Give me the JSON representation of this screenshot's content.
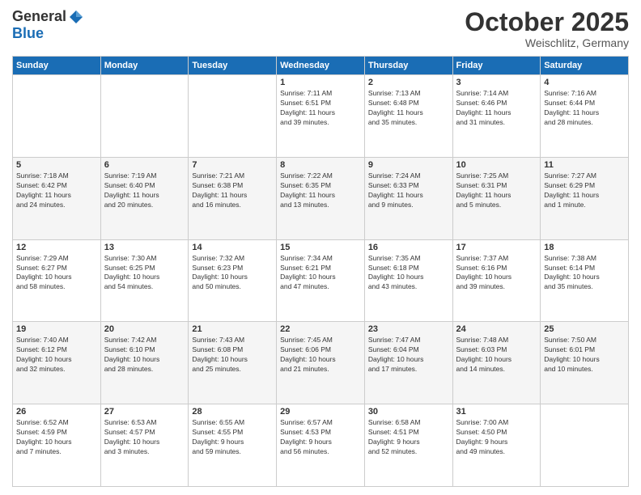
{
  "logo": {
    "general": "General",
    "blue": "Blue"
  },
  "title": "October 2025",
  "subtitle": "Weischlitz, Germany",
  "days_of_week": [
    "Sunday",
    "Monday",
    "Tuesday",
    "Wednesday",
    "Thursday",
    "Friday",
    "Saturday"
  ],
  "weeks": [
    [
      {
        "day": "",
        "info": ""
      },
      {
        "day": "",
        "info": ""
      },
      {
        "day": "",
        "info": ""
      },
      {
        "day": "1",
        "info": "Sunrise: 7:11 AM\nSunset: 6:51 PM\nDaylight: 11 hours\nand 39 minutes."
      },
      {
        "day": "2",
        "info": "Sunrise: 7:13 AM\nSunset: 6:48 PM\nDaylight: 11 hours\nand 35 minutes."
      },
      {
        "day": "3",
        "info": "Sunrise: 7:14 AM\nSunset: 6:46 PM\nDaylight: 11 hours\nand 31 minutes."
      },
      {
        "day": "4",
        "info": "Sunrise: 7:16 AM\nSunset: 6:44 PM\nDaylight: 11 hours\nand 28 minutes."
      }
    ],
    [
      {
        "day": "5",
        "info": "Sunrise: 7:18 AM\nSunset: 6:42 PM\nDaylight: 11 hours\nand 24 minutes."
      },
      {
        "day": "6",
        "info": "Sunrise: 7:19 AM\nSunset: 6:40 PM\nDaylight: 11 hours\nand 20 minutes."
      },
      {
        "day": "7",
        "info": "Sunrise: 7:21 AM\nSunset: 6:38 PM\nDaylight: 11 hours\nand 16 minutes."
      },
      {
        "day": "8",
        "info": "Sunrise: 7:22 AM\nSunset: 6:35 PM\nDaylight: 11 hours\nand 13 minutes."
      },
      {
        "day": "9",
        "info": "Sunrise: 7:24 AM\nSunset: 6:33 PM\nDaylight: 11 hours\nand 9 minutes."
      },
      {
        "day": "10",
        "info": "Sunrise: 7:25 AM\nSunset: 6:31 PM\nDaylight: 11 hours\nand 5 minutes."
      },
      {
        "day": "11",
        "info": "Sunrise: 7:27 AM\nSunset: 6:29 PM\nDaylight: 11 hours\nand 1 minute."
      }
    ],
    [
      {
        "day": "12",
        "info": "Sunrise: 7:29 AM\nSunset: 6:27 PM\nDaylight: 10 hours\nand 58 minutes."
      },
      {
        "day": "13",
        "info": "Sunrise: 7:30 AM\nSunset: 6:25 PM\nDaylight: 10 hours\nand 54 minutes."
      },
      {
        "day": "14",
        "info": "Sunrise: 7:32 AM\nSunset: 6:23 PM\nDaylight: 10 hours\nand 50 minutes."
      },
      {
        "day": "15",
        "info": "Sunrise: 7:34 AM\nSunset: 6:21 PM\nDaylight: 10 hours\nand 47 minutes."
      },
      {
        "day": "16",
        "info": "Sunrise: 7:35 AM\nSunset: 6:18 PM\nDaylight: 10 hours\nand 43 minutes."
      },
      {
        "day": "17",
        "info": "Sunrise: 7:37 AM\nSunset: 6:16 PM\nDaylight: 10 hours\nand 39 minutes."
      },
      {
        "day": "18",
        "info": "Sunrise: 7:38 AM\nSunset: 6:14 PM\nDaylight: 10 hours\nand 35 minutes."
      }
    ],
    [
      {
        "day": "19",
        "info": "Sunrise: 7:40 AM\nSunset: 6:12 PM\nDaylight: 10 hours\nand 32 minutes."
      },
      {
        "day": "20",
        "info": "Sunrise: 7:42 AM\nSunset: 6:10 PM\nDaylight: 10 hours\nand 28 minutes."
      },
      {
        "day": "21",
        "info": "Sunrise: 7:43 AM\nSunset: 6:08 PM\nDaylight: 10 hours\nand 25 minutes."
      },
      {
        "day": "22",
        "info": "Sunrise: 7:45 AM\nSunset: 6:06 PM\nDaylight: 10 hours\nand 21 minutes."
      },
      {
        "day": "23",
        "info": "Sunrise: 7:47 AM\nSunset: 6:04 PM\nDaylight: 10 hours\nand 17 minutes."
      },
      {
        "day": "24",
        "info": "Sunrise: 7:48 AM\nSunset: 6:03 PM\nDaylight: 10 hours\nand 14 minutes."
      },
      {
        "day": "25",
        "info": "Sunrise: 7:50 AM\nSunset: 6:01 PM\nDaylight: 10 hours\nand 10 minutes."
      }
    ],
    [
      {
        "day": "26",
        "info": "Sunrise: 6:52 AM\nSunset: 4:59 PM\nDaylight: 10 hours\nand 7 minutes."
      },
      {
        "day": "27",
        "info": "Sunrise: 6:53 AM\nSunset: 4:57 PM\nDaylight: 10 hours\nand 3 minutes."
      },
      {
        "day": "28",
        "info": "Sunrise: 6:55 AM\nSunset: 4:55 PM\nDaylight: 9 hours\nand 59 minutes."
      },
      {
        "day": "29",
        "info": "Sunrise: 6:57 AM\nSunset: 4:53 PM\nDaylight: 9 hours\nand 56 minutes."
      },
      {
        "day": "30",
        "info": "Sunrise: 6:58 AM\nSunset: 4:51 PM\nDaylight: 9 hours\nand 52 minutes."
      },
      {
        "day": "31",
        "info": "Sunrise: 7:00 AM\nSunset: 4:50 PM\nDaylight: 9 hours\nand 49 minutes."
      },
      {
        "day": "",
        "info": ""
      }
    ]
  ]
}
